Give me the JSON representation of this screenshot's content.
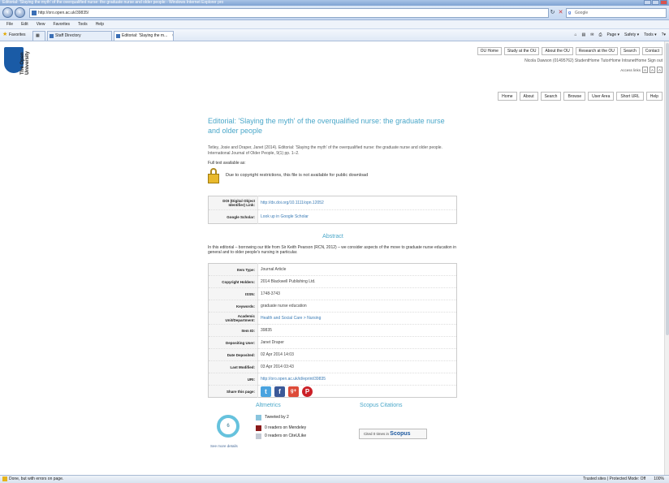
{
  "browser": {
    "window_title": "Editorial: 'Slaying the myth' of the overqualified nurse: the graduate nurse and older people - Windows Internet Explorer pro",
    "url": "http://oro.open.ac.uk/39835/",
    "search_placeholder": "Google",
    "menu": [
      "File",
      "Edit",
      "View",
      "Favorites",
      "Tools",
      "Help"
    ],
    "favorites_label": "Favorites",
    "tabs": [
      {
        "label": "Staff Directory",
        "active": false
      },
      {
        "label": "Editorial: 'Slaying the m...",
        "active": true
      }
    ],
    "commands": [
      "Page ▾",
      "Safety ▾",
      "Tools ▾",
      "?▾"
    ],
    "status": {
      "left": "Done, but with errors on page.",
      "zone": "Trusted sites | Protected Mode: Off",
      "zoom": "100%"
    }
  },
  "site": {
    "logo_lines": [
      "The Open",
      "University"
    ],
    "top_links": [
      "OU Home",
      "Study at the OU",
      "About the OU",
      "Research at the OU",
      "Search",
      "Contact"
    ],
    "user_line": "Nicola Dawson (01495762)    StudentHome  TutorHome  IntranetHome  Sign out",
    "accessibility_label": "Access links",
    "access_boxes": [
      "A",
      "A",
      "A"
    ],
    "nav": [
      "Home",
      "About",
      "Search",
      "Browse",
      "User Area",
      "Short URL",
      "Help"
    ]
  },
  "article": {
    "title": "Editorial: 'Slaying the myth' of the overqualified nurse: the graduate nurse and older people",
    "citation": "Tetley, Josie and Draper, Janet (2014). Editorial: 'Slaying the myth' of the overqualified nurse: the graduate nurse and older people. International Journal of Older People, 9(1) pp. 1–2.",
    "fulltext_label": "Full text available as:",
    "restriction_text": "Due to copyright restrictions, this file is not available for public download",
    "doi_table": [
      {
        "label": "DOI (Digital Object Identifier) Link:",
        "value": "http://dx.doi.org/10.1111/opn.12052",
        "link": true
      },
      {
        "label": "Google Scholar:",
        "value": "Look up in Google Scholar",
        "link": true
      }
    ],
    "abstract_heading": "Abstract",
    "abstract_text": "In this editorial – borrowing our title from Sir Keith Pearson (RCN, 2012) – we consider aspects of the move to graduate nurse education in general and to older people's nursing in particular.",
    "meta_table": [
      {
        "label": "Item Type:",
        "value": "Journal Article",
        "link": false
      },
      {
        "label": "Copyright Holders:",
        "value": "2014 Blackwell Publishing Ltd.",
        "link": false
      },
      {
        "label": "ISSN:",
        "value": "1748-3743",
        "link": false
      },
      {
        "label": "Keywords:",
        "value": "graduate nurse education",
        "link": false
      },
      {
        "label": "Academic Unit/Department:",
        "value": "Health and Social Care > Nursing",
        "link": true
      },
      {
        "label": "Item ID:",
        "value": "39835",
        "link": false
      },
      {
        "label": "Depositing User:",
        "value": "Janet Draper",
        "link": false
      },
      {
        "label": "Date Deposited:",
        "value": "02 Apr 2014 14:03",
        "link": false
      },
      {
        "label": "Last Modified:",
        "value": "03 Apr 2014 03:43",
        "link": false
      },
      {
        "label": "URI:",
        "value": "http://oro.open.ac.uk/id/eprint/39835",
        "link": true
      }
    ],
    "share_label": "Share this page:",
    "share_icons": [
      {
        "name": "twitter-icon",
        "glyph": "🐦"
      },
      {
        "name": "facebook-icon",
        "glyph": "f"
      },
      {
        "name": "google-plus-icon",
        "glyph": "g+"
      },
      {
        "name": "pinterest-icon",
        "glyph": "P"
      }
    ]
  },
  "metrics": {
    "altmetric_heading": "Altmetrics",
    "scopus_heading": "Scopus Citations",
    "altmetric_score": "6",
    "see_more": "See more details",
    "rows": [
      {
        "text": "Tweeted by 2",
        "color": "#8ac5de"
      },
      {
        "text": "0 readers on Mendeley",
        "color": "#8b1a1a"
      },
      {
        "text": "0 readers on CiteULike",
        "color": "#c3c9d3"
      }
    ],
    "scopus_prefix": "Cited 0 times in",
    "scopus_brand": "Scopus"
  }
}
